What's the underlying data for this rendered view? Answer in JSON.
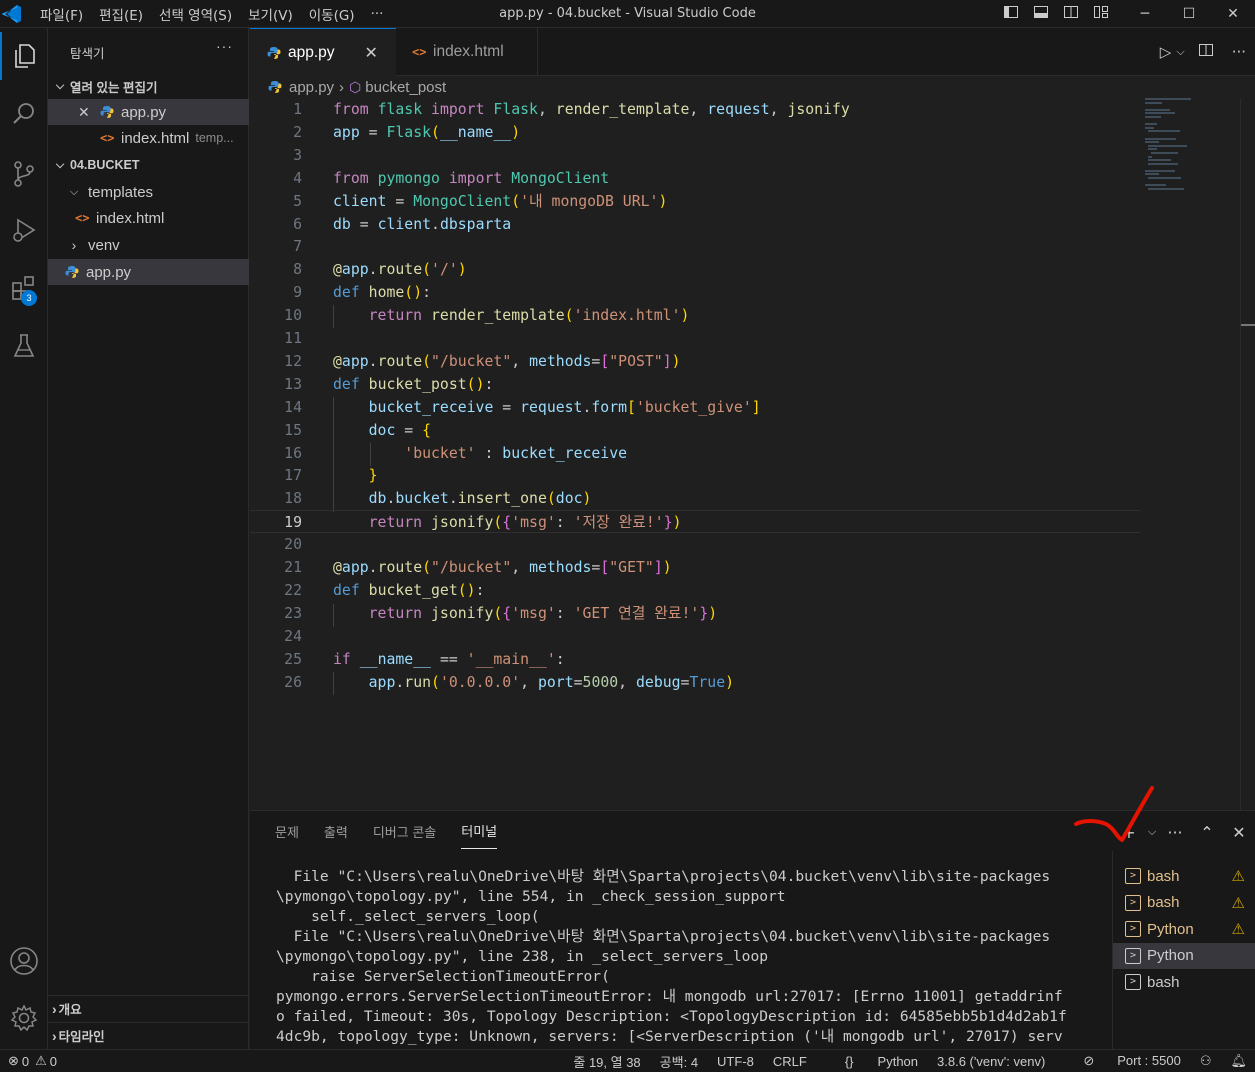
{
  "titlebar": {
    "menu": [
      "파일(F)",
      "편집(E)",
      "선택 영역(S)",
      "보기(V)",
      "이동(G)"
    ],
    "more": "···",
    "title": "app.py - 04.bucket - Visual Studio Code"
  },
  "activitybar": {
    "extensions_badge": "3"
  },
  "sidebar": {
    "title": "탐색기",
    "more": "···",
    "open_editors": {
      "label": "열려 있는 편집기",
      "items": [
        {
          "name": "app.py",
          "hint": ""
        },
        {
          "name": "index.html",
          "hint": "temp..."
        }
      ]
    },
    "folder": {
      "label": "04.BUCKET",
      "items": [
        {
          "name": "templates"
        },
        {
          "name": "index.html"
        },
        {
          "name": "venv"
        },
        {
          "name": "app.py"
        }
      ]
    },
    "outline_label": "개요",
    "timeline_label": "타임라인"
  },
  "tabs": [
    {
      "label": "app.py",
      "active": true
    },
    {
      "label": "index.html",
      "active": false
    }
  ],
  "breadcrumb": {
    "file": "app.py",
    "symbol": "bucket_post"
  },
  "editor": {
    "current_line": 19,
    "lines": [
      "from flask import Flask, render_template, request, jsonify",
      "app = Flask(__name__)",
      "",
      "from pymongo import MongoClient",
      "client = MongoClient('내 mongoDB URL')",
      "db = client.dbsparta",
      "",
      "@app.route('/')",
      "def home():",
      "    return render_template('index.html')",
      "",
      "@app.route(\"/bucket\", methods=[\"POST\"])",
      "def bucket_post():",
      "    bucket_receive = request.form['bucket_give']",
      "    doc = {",
      "        'bucket' : bucket_receive",
      "    }",
      "    db.bucket.insert_one(doc)",
      "    return jsonify({'msg': '저장 완료!'})",
      "",
      "@app.route(\"/bucket\", methods=[\"GET\"])",
      "def bucket_get():",
      "    return jsonify({'msg': 'GET 연결 완료!'})",
      "",
      "if __name__ == '__main__':",
      "    app.run('0.0.0.0', port=5000, debug=True)"
    ]
  },
  "panel": {
    "tabs": [
      {
        "label": "문제",
        "active": false
      },
      {
        "label": "출력",
        "active": false
      },
      {
        "label": "디버그 콘솔",
        "active": false
      },
      {
        "label": "터미널",
        "active": true
      }
    ],
    "terminal_lines": [
      "  File \"C:\\Users\\realu\\OneDrive\\바탕 화면\\Sparta\\projects\\04.bucket\\venv\\lib\\site-packages",
      "\\pymongo\\topology.py\", line 554, in _check_session_support",
      "    self._select_servers_loop(",
      "  File \"C:\\Users\\realu\\OneDrive\\바탕 화면\\Sparta\\projects\\04.bucket\\venv\\lib\\site-packages",
      "\\pymongo\\topology.py\", line 238, in _select_servers_loop",
      "    raise ServerSelectionTimeoutError(",
      "pymongo.errors.ServerSelectionTimeoutError: 내 mongodb url:27017: [Errno 11001] getaddrinf",
      "o failed, Timeout: 30s, Topology Description: <TopologyDescription id: 64585ebb5b1d4d2ab1f",
      "4dc9b, topology_type: Unknown, servers: [<ServerDescription ('내 mongodb url', 27017) serv"
    ],
    "terminals": [
      {
        "name": "bash",
        "warning": true,
        "selected": false
      },
      {
        "name": "bash",
        "warning": true,
        "selected": false
      },
      {
        "name": "Python",
        "warning": true,
        "selected": false
      },
      {
        "name": "Python",
        "warning": false,
        "selected": true
      },
      {
        "name": "bash",
        "warning": false,
        "selected": false
      }
    ]
  },
  "statusbar": {
    "errors": "0",
    "warnings": "0",
    "position": "줄 19, 열 38",
    "spaces": "공백: 4",
    "encoding": "UTF-8",
    "eol": "CRLF",
    "language": "Python",
    "interpreter": "3.8.6 ('venv': venv)",
    "port": "Port : 5500"
  },
  "colors": {
    "accent": "#0078d4",
    "annotation": "#e51400",
    "warning": "#cca700"
  }
}
